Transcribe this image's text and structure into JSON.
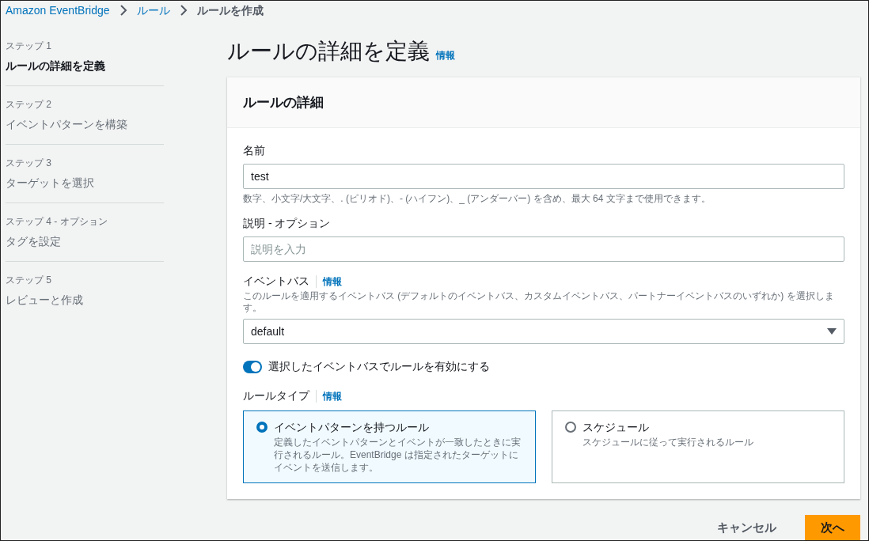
{
  "breadcrumb": [
    {
      "label": "Amazon EventBridge",
      "current": false
    },
    {
      "label": "ルール",
      "current": false
    },
    {
      "label": "ルールを作成",
      "current": true
    }
  ],
  "steps": [
    {
      "step": "ステップ 1",
      "title": "ルールの詳細を定義",
      "selected": true
    },
    {
      "step": "ステップ 2",
      "title": "イベントパターンを構築",
      "selected": false
    },
    {
      "step": "ステップ 3",
      "title": "ターゲットを選択",
      "selected": false
    },
    {
      "step": "ステップ 4 - オプション",
      "title": "タグを設定",
      "selected": false
    },
    {
      "step": "ステップ 5",
      "title": "レビューと作成",
      "selected": false
    }
  ],
  "page_title": "ルールの詳細を定義",
  "page_info": "情報",
  "card": {
    "title": "ルールの詳細",
    "name_field": {
      "label": "名前",
      "value": "test",
      "hint": "数字、小文字/大文字、. (ピリオド)、- (ハイフン)、_ (アンダーバー) を含め、最大 64 文字まで使用できます。"
    },
    "description_field": {
      "label": "説明 - オプション",
      "placeholder": "説明を入力"
    },
    "event_bus": {
      "label": "イベントバス",
      "info": "情報",
      "description": "このルールを適用するイベントバス (デフォルトのイベントバス、カスタムイベントバス、パートナーイベントバスのいずれか) を選択します。",
      "value": "default"
    },
    "enable_toggle": {
      "label": "選択したイベントバスでルールを有効にする",
      "on": true
    },
    "rule_type": {
      "label": "ルールタイプ",
      "info": "情報",
      "options": [
        {
          "title": "イベントパターンを持つルール",
          "description": "定義したイベントパターンとイベントが一致したときに実行されるルール。EventBridge は指定されたターゲットにイベントを送信します。",
          "selected": true
        },
        {
          "title": "スケジュール",
          "description": "スケジュールに従って実行されるルール",
          "selected": false
        }
      ]
    }
  },
  "buttons": {
    "cancel": "キャンセル",
    "next": "次へ"
  }
}
